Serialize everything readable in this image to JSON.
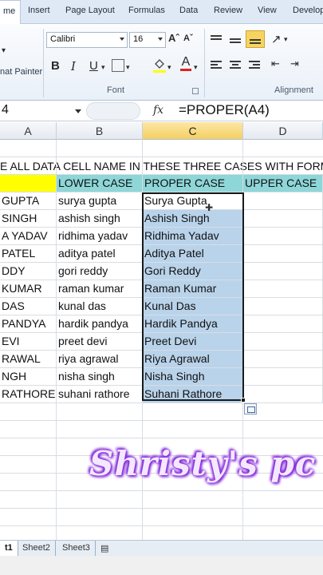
{
  "ribbon": {
    "tabs": [
      "me",
      "Insert",
      "Page Layout",
      "Formulas",
      "Data",
      "Review",
      "View",
      "Develop"
    ],
    "font_name": "Calibri",
    "font_size": "16",
    "bold": "B",
    "italic": "I",
    "underline": "U",
    "font_color_glyph": "A",
    "painter_label": "nat Painter",
    "group_font": "Font",
    "group_alignment": "Alignment"
  },
  "formula_bar": {
    "name_box": "4",
    "fx": "fx",
    "formula": "=PROPER(A4)"
  },
  "grid": {
    "columns": [
      "A",
      "B",
      "C",
      "D"
    ],
    "selected_column": "C",
    "banner": "E ALL DATA CELL NAME IN THESE THREE CASES WITH FORMULA",
    "headers": {
      "a": "",
      "b": "LOWER CASE",
      "c": "PROPER CASE",
      "d": "UPPER CASE"
    },
    "rows": [
      {
        "a": "GUPTA",
        "b": "surya gupta",
        "c": "Surya Gupta"
      },
      {
        "a": "SINGH",
        "b": "ashish singh",
        "c": "Ashish Singh"
      },
      {
        "a": "A YADAV",
        "b": "ridhima yadav",
        "c": "Ridhima Yadav"
      },
      {
        "a": "PATEL",
        "b": "aditya patel",
        "c": "Aditya Patel"
      },
      {
        "a": "DDY",
        "b": "gori reddy",
        "c": "Gori Reddy"
      },
      {
        "a": "KUMAR",
        "b": "raman kumar",
        "c": "Raman Kumar"
      },
      {
        "a": "DAS",
        "b": "kunal das",
        "c": "Kunal Das"
      },
      {
        "a": "PANDYA",
        "b": "hardik pandya",
        "c": "Hardik Pandya"
      },
      {
        "a": "EVI",
        "b": "preet devi",
        "c": "Preet Devi"
      },
      {
        "a": "RAWAL",
        "b": "riya agrawal",
        "c": "Riya Agrawal"
      },
      {
        "a": "NGH",
        "b": "nisha singh",
        "c": "Nisha Singh"
      },
      {
        "a": "RATHORE",
        "b": "suhani rathore",
        "c": "Suhani Rathore"
      }
    ]
  },
  "watermark": "Shristy's pc",
  "sheets": {
    "tabs": [
      "t1",
      "Sheet2",
      "Sheet3"
    ],
    "active_index": 0
  },
  "colors": {
    "header_yellow": "#ffff00",
    "header_teal": "#8ed6d8",
    "selection": "#b9d3ea",
    "watermark_glow": "#8a2be2"
  }
}
